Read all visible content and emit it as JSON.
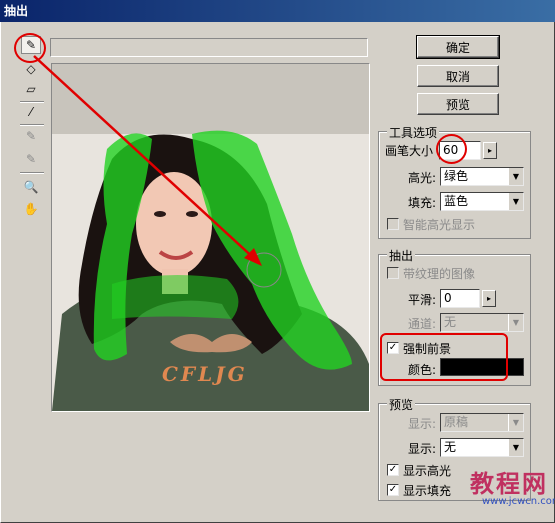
{
  "window": {
    "title": "抽出"
  },
  "tools": [
    {
      "name": "edge-highlighter-icon",
      "glyph": "✎",
      "active": true,
      "disabled": false
    },
    {
      "name": "fill-icon",
      "glyph": "◇",
      "disabled": false
    },
    {
      "name": "eraser-icon",
      "glyph": "▱",
      "disabled": false
    },
    {
      "name": "eyedropper-icon",
      "glyph": "⁄",
      "disabled": false
    },
    {
      "name": "cleanup-icon",
      "glyph": "✎",
      "disabled": true
    },
    {
      "name": "edge-touchup-icon",
      "glyph": "✎",
      "disabled": true
    },
    {
      "name": "zoom-icon",
      "glyph": "🔍",
      "disabled": false
    },
    {
      "name": "hand-icon",
      "glyph": "✋",
      "disabled": false
    }
  ],
  "buttons": {
    "ok": "确定",
    "cancel": "取消",
    "preview": "预览"
  },
  "tool_options": {
    "title": "工具选项",
    "brush_size_label": "画笔大小",
    "brush_size": "60",
    "highlight_label": "高光:",
    "highlight_value": "绿色",
    "fill_label": "填充:",
    "fill_value": "蓝色",
    "smart_highlight_label": "智能高光显示",
    "smart_highlight_checked": false
  },
  "extraction": {
    "title": "抽出",
    "textured_label": "带纹理的图像",
    "textured_checked": false,
    "smooth_label": "平滑:",
    "smooth_value": "0",
    "channel_label": "通道:",
    "channel_value": "无",
    "force_fg_label": "强制前景",
    "force_fg_checked": true,
    "color_label": "颜色:",
    "color_value": "#000000"
  },
  "preview": {
    "title": "预览",
    "show_label": "显示:",
    "show_value": "原稿",
    "display_label": "显示:",
    "display_value": "无",
    "show_highlight_label": "显示高光",
    "show_highlight_checked": true,
    "show_fill_label": "显示填充",
    "show_fill_checked": true
  },
  "image_text": {
    "logo": "CFLJG"
  },
  "watermark": {
    "main": "教程网",
    "url": "www.jcwcn.com"
  },
  "colors": {
    "highlight_green": "#22d222",
    "annotation_red": "#e00000",
    "title_blue": "#0a246a"
  }
}
